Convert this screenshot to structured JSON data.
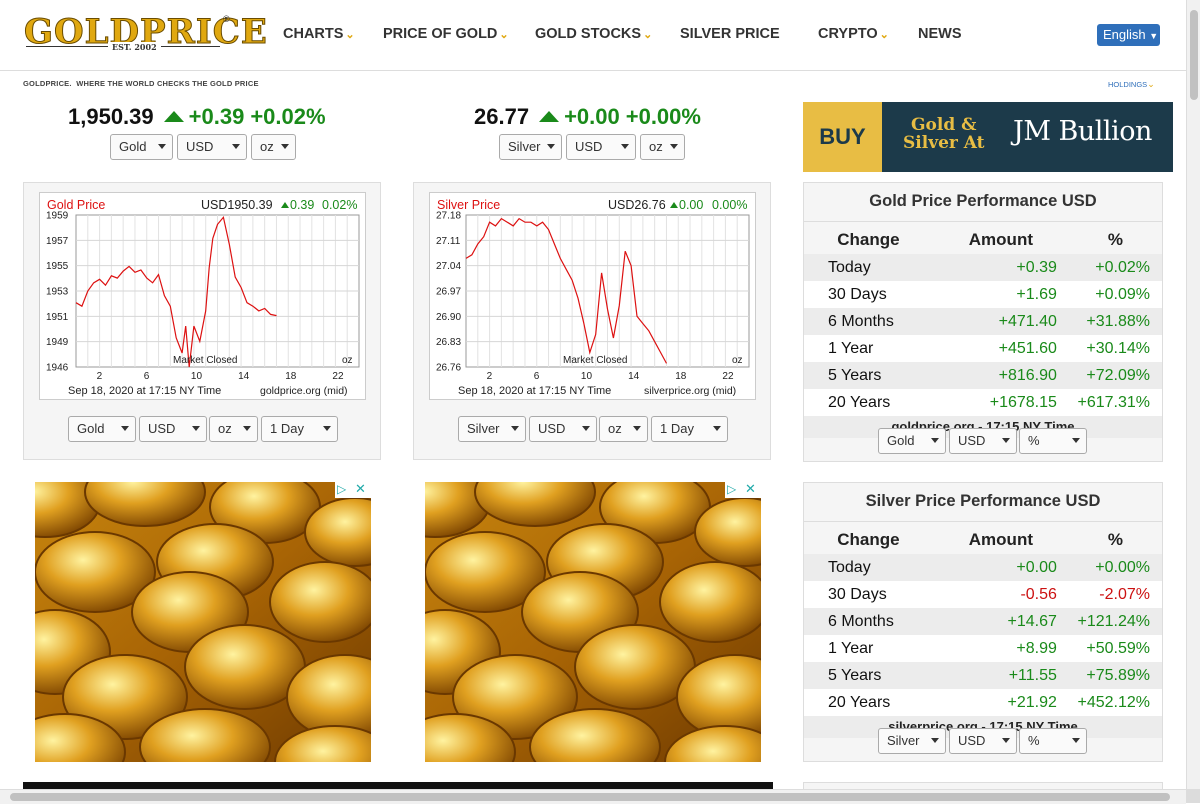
{
  "header": {
    "logo_text": "GOLDPRICE",
    "logo_est": "EST. 2002",
    "logo_reg": "®",
    "nav": [
      {
        "label": "CHARTS",
        "dropdown": true
      },
      {
        "label": "PRICE OF GOLD",
        "dropdown": true
      },
      {
        "label": "GOLD STOCKS",
        "dropdown": true
      },
      {
        "label": "SILVER PRICE",
        "dropdown": false
      },
      {
        "label": "CRYPTO",
        "dropdown": true
      },
      {
        "label": "NEWS",
        "dropdown": false
      }
    ],
    "language": "English"
  },
  "subheader": {
    "tagline_brand": "GOLDPRICE.",
    "tagline": "WHERE THE WORLD CHECKS THE GOLD PRICE",
    "holdings": "HOLDINGS"
  },
  "gold_quote": {
    "price": "1,950.39",
    "change": "+0.39",
    "pct": "+0.02%",
    "metal": "Gold",
    "currency": "USD",
    "unit": "oz"
  },
  "silver_quote": {
    "price": "26.77",
    "change": "+0.00",
    "pct": "+0.00%",
    "metal": "Silver",
    "currency": "USD",
    "unit": "oz"
  },
  "gold_chart": {
    "title": "Gold Price",
    "quote": "USD1950.39",
    "change": "0.39",
    "pct": "0.02%",
    "status": "Market Closed",
    "unit": "oz",
    "footer_time": "Sep 18, 2020 at 17:15 NY Time",
    "footer_src": "goldprice.org (mid)",
    "controls": {
      "metal": "Gold",
      "currency": "USD",
      "unit": "oz",
      "range": "1 Day"
    }
  },
  "silver_chart": {
    "title": "Silver Price",
    "quote": "USD26.76",
    "change": "0.00",
    "pct": "0.00%",
    "status": "Market Closed",
    "unit": "oz",
    "footer_time": "Sep 18, 2020 at 17:15 NY Time",
    "footer_src": "silverprice.org (mid)",
    "controls": {
      "metal": "Silver",
      "currency": "USD",
      "unit": "oz",
      "range": "1 Day"
    }
  },
  "chart_data": [
    {
      "type": "line",
      "title": "Gold Price",
      "x_ticks": [
        "2",
        "6",
        "10",
        "14",
        "18",
        "22"
      ],
      "y_ticks": [
        "1959",
        "1957",
        "1955",
        "1953",
        "1951",
        "1949",
        "1946"
      ],
      "xlim": [
        0,
        24
      ],
      "ylim": [
        1946,
        1959
      ],
      "color": "#dd1111",
      "x": [
        0,
        0.5,
        1,
        1.5,
        2,
        2.5,
        3,
        3.5,
        4,
        4.5,
        5,
        5.5,
        6,
        6.5,
        7,
        7.5,
        8,
        8.5,
        9,
        9.3,
        9.6,
        10,
        10.5,
        11,
        11.3,
        11.6,
        12,
        12.5,
        13,
        13.5,
        14,
        14.5,
        15,
        15.5,
        16,
        16.5,
        17
      ],
      "y": [
        1951.5,
        1951.2,
        1952.5,
        1953.2,
        1953.5,
        1953.0,
        1953.8,
        1953.6,
        1954.2,
        1954.6,
        1954.1,
        1954.3,
        1953.6,
        1953.2,
        1953.9,
        1952.1,
        1951.2,
        1948.5,
        1947.2,
        1949.5,
        1946.0,
        1949.5,
        1948.2,
        1950.8,
        1954.5,
        1957.0,
        1958.2,
        1958.8,
        1956.5,
        1953.7,
        1952.8,
        1951.5,
        1951.2,
        1950.8,
        1951.0,
        1950.5,
        1950.4
      ]
    },
    {
      "type": "line",
      "title": "Silver Price",
      "x_ticks": [
        "2",
        "6",
        "10",
        "14",
        "18",
        "22"
      ],
      "y_ticks": [
        "27.18",
        "27.11",
        "27.04",
        "26.97",
        "26.90",
        "26.83",
        "26.76"
      ],
      "xlim": [
        0,
        24
      ],
      "ylim": [
        26.76,
        27.18
      ],
      "color": "#dd1111",
      "x": [
        0,
        0.5,
        1,
        1.5,
        2,
        2.5,
        3,
        3.5,
        4,
        4.5,
        5,
        5.5,
        6,
        6.5,
        7,
        7.5,
        8,
        8.5,
        9,
        9.5,
        10,
        10.5,
        11,
        11.5,
        12,
        12.5,
        13,
        13.5,
        14,
        14.5,
        15,
        15.5,
        16,
        16.5,
        17
      ],
      "y": [
        27.06,
        27.07,
        27.1,
        27.12,
        27.16,
        27.15,
        27.17,
        27.16,
        27.15,
        27.17,
        27.16,
        27.16,
        27.15,
        27.16,
        27.14,
        27.1,
        27.06,
        27.03,
        27.0,
        26.95,
        26.88,
        26.8,
        26.85,
        27.02,
        26.92,
        26.84,
        26.93,
        27.08,
        27.04,
        26.9,
        26.88,
        26.86,
        26.83,
        26.8,
        26.77
      ]
    }
  ],
  "buy_banner": {
    "buy": "BUY",
    "line1": "Gold &",
    "line2": "Silver At",
    "brand": "JM Bullion"
  },
  "gold_perf": {
    "title": "Gold Price Performance USD",
    "headers": [
      "Change",
      "Amount",
      "%"
    ],
    "rows": [
      {
        "label": "Today",
        "amount": "+0.39",
        "pct": "+0.02%",
        "neg": false
      },
      {
        "label": "30 Days",
        "amount": "+1.69",
        "pct": "+0.09%",
        "neg": false
      },
      {
        "label": "6 Months",
        "amount": "+471.40",
        "pct": "+31.88%",
        "neg": false
      },
      {
        "label": "1 Year",
        "amount": "+451.60",
        "pct": "+30.14%",
        "neg": false
      },
      {
        "label": "5 Years",
        "amount": "+816.90",
        "pct": "+72.09%",
        "neg": false
      },
      {
        "label": "20 Years",
        "amount": "+1678.15",
        "pct": "+617.31%",
        "neg": false
      }
    ],
    "source": "goldprice.org - 17:15 NY Time",
    "controls": {
      "metal": "Gold",
      "currency": "USD",
      "mode": "%"
    }
  },
  "silver_perf": {
    "title": "Silver Price Performance USD",
    "headers": [
      "Change",
      "Amount",
      "%"
    ],
    "rows": [
      {
        "label": "Today",
        "amount": "+0.00",
        "pct": "+0.00%",
        "neg": false
      },
      {
        "label": "30 Days",
        "amount": "-0.56",
        "pct": "-2.07%",
        "neg": true
      },
      {
        "label": "6 Months",
        "amount": "+14.67",
        "pct": "+121.24%",
        "neg": false
      },
      {
        "label": "1 Year",
        "amount": "+8.99",
        "pct": "+50.59%",
        "neg": false
      },
      {
        "label": "5 Years",
        "amount": "+11.55",
        "pct": "+75.89%",
        "neg": false
      },
      {
        "label": "20 Years",
        "amount": "+21.92",
        "pct": "+452.12%",
        "neg": false
      }
    ],
    "source": "silverprice.org - 17:15 NY Time",
    "controls": {
      "metal": "Silver",
      "currency": "USD",
      "mode": "%"
    }
  },
  "colors": {
    "gold_accent": "#e0a810",
    "up": "#1a8a1a",
    "down": "#cc1111",
    "link": "#2f6fba",
    "line": "#dd1111"
  },
  "icons": {
    "up_arrow": "triangle-up-icon",
    "chevron": "chevron-down-icon",
    "ad_choices": "adchoices-icon",
    "ad_close": "close-icon"
  }
}
